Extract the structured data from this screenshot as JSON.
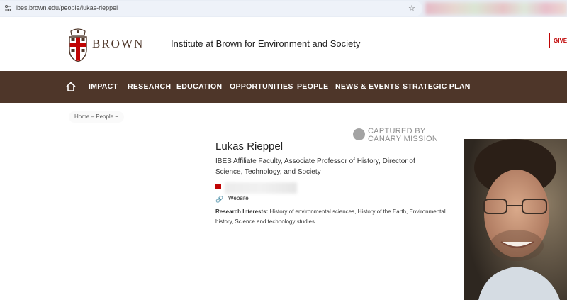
{
  "browser": {
    "url": "ibes.brown.edu/people/lukas-rieppel"
  },
  "header": {
    "logo_text": "BROWN",
    "site_title": "Institute at Brown for Environment and Society",
    "give_label": "GIVE"
  },
  "nav": {
    "items": [
      "IMPACT",
      "RESEARCH",
      "EDUCATION",
      "OPPORTUNITIES",
      "PEOPLE",
      "NEWS & EVENTS",
      "STRATEGIC PLAN"
    ]
  },
  "breadcrumb": {
    "text": "Home – People ¬"
  },
  "watermark": {
    "line1": "CAPTURED BY",
    "line2": "CANARY MISSION"
  },
  "profile": {
    "name": "Lukas Rieppel",
    "role": "IBES Affiliate Faculty, Associate Professor of History, Director of Science, Technology, and Society",
    "website_label": "Website",
    "interests_label": "Research Interests:",
    "interests": "History of environmental sciences, History of the Earth, Environmental history, Science and technology studies"
  },
  "colors": {
    "brown": "#4e3629",
    "red": "#c00404"
  }
}
